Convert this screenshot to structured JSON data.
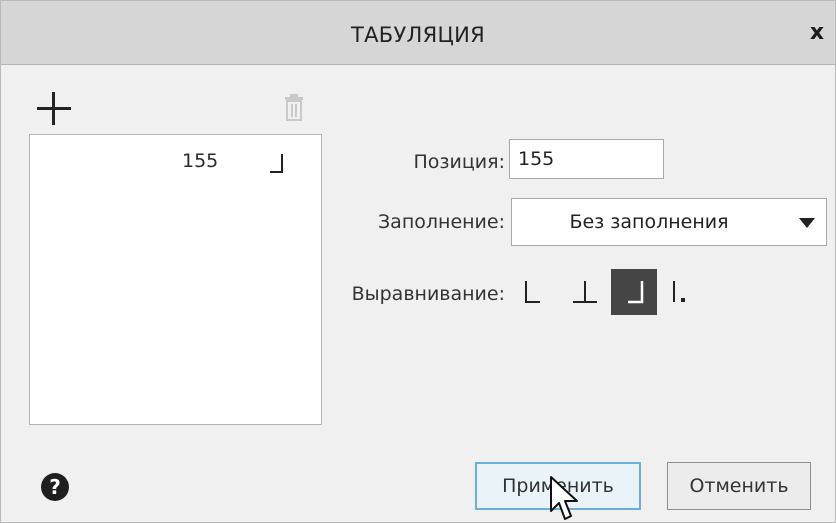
{
  "dialog": {
    "title": "ТАБУЛЯЦИЯ",
    "close_icon": "close-icon",
    "close_glyph": "x"
  },
  "toolbar": {
    "add_icon": "plus-icon",
    "delete_icon": "trash-icon"
  },
  "tab_list": {
    "items": [
      {
        "value": "155",
        "alignment": "right",
        "icon": "tab-right-align-icon"
      }
    ]
  },
  "form": {
    "position_label": "Позиция:",
    "position_value": "155",
    "fill_label": "Заполнение:",
    "fill_value": "Без заполнения",
    "alignment_label": "Выравнивание:",
    "alignment_options": [
      {
        "name": "left",
        "icon": "align-left-tab-icon",
        "selected": false
      },
      {
        "name": "center",
        "icon": "align-center-tab-icon",
        "selected": false
      },
      {
        "name": "right",
        "icon": "align-right-tab-icon",
        "selected": true
      },
      {
        "name": "decimal",
        "icon": "align-decimal-tab-icon",
        "selected": false
      }
    ]
  },
  "footer": {
    "help_icon": "help-icon",
    "help_glyph": "?",
    "apply_label": "Применить",
    "cancel_label": "Отменить"
  },
  "colors": {
    "titlebar": "#d6d6d6",
    "background": "#f0f0f0",
    "selected_toggle": "#454545",
    "focus_border": "#6ab0d4"
  }
}
